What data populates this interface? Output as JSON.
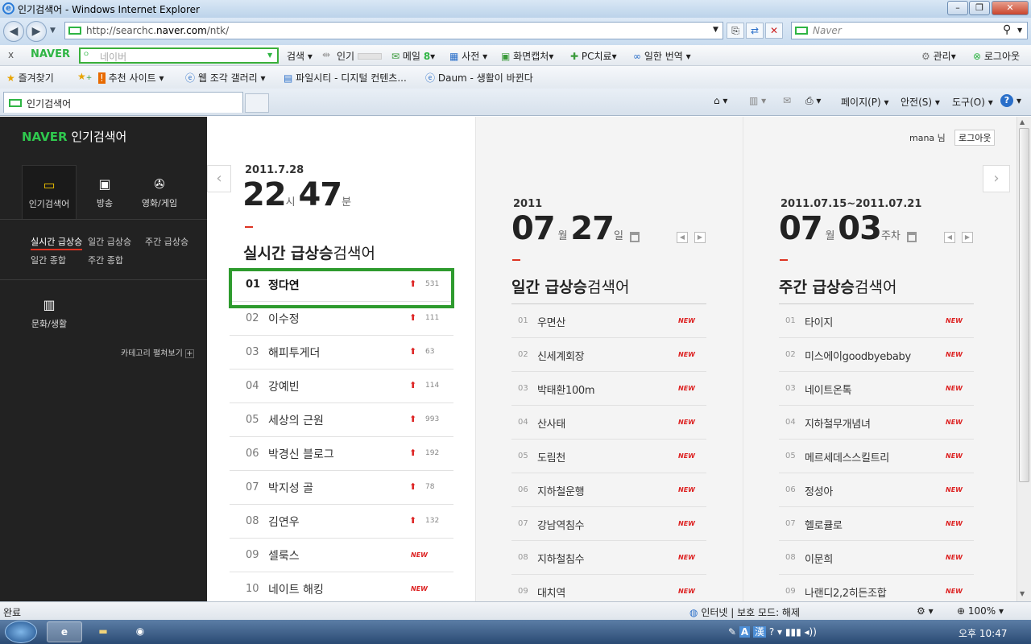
{
  "window": {
    "title": "인기검색어 - Windows Internet Explorer"
  },
  "address": {
    "url_prefix": "http://searchc.",
    "url_domain": "naver.com",
    "url_path": "/ntk/"
  },
  "search": {
    "placeholder": "Naver"
  },
  "naver_toolbar": {
    "close": "x",
    "logo": "NAVER",
    "placeholder": "네이버",
    "search": "검색",
    "popular": "인기",
    "mail": "메일",
    "mail_count": "8",
    "dict": "사전",
    "capture": "화면캡처",
    "pc": "PC치료",
    "translate": "일한 번역",
    "manage": "관리",
    "logout": "로그아웃"
  },
  "favorites": {
    "label": "즐겨찾기",
    "items": [
      "추천 사이트",
      "웹 조각 갤러리",
      "파일시티 - 디지털 컨텐츠...",
      "Daum - 생활이 바뀐다"
    ]
  },
  "tabs": {
    "active": "인기검색어"
  },
  "cmdbar": {
    "page": "페이지(P)",
    "safety": "안전(S)",
    "tools": "도구(O)"
  },
  "sidebar": {
    "brand_logo": "NAVER",
    "brand_text": "인기검색어",
    "icons": [
      {
        "label": "인기검색어",
        "icon": "ticket-icon"
      },
      {
        "label": "방송",
        "icon": "tv-icon"
      },
      {
        "label": "영화/게임",
        "icon": "film-reel-icon"
      }
    ],
    "submenu": [
      "실시간 급상승",
      "일간 급상승",
      "주간 급상승",
      "일간 종합",
      "주간 종합"
    ],
    "culture": "문화/생활",
    "expand": "카테고리 펼쳐보기"
  },
  "user": {
    "name": "mana",
    "suffix": "님",
    "logout": "로그아웃"
  },
  "realtime": {
    "date": "2011.7.28",
    "hour": "22",
    "hour_unit": "시",
    "minute": "47",
    "minute_unit": "분",
    "heading_bold": "실시간 급상승",
    "heading": "검색어",
    "items": [
      {
        "rank": "01",
        "keyword": "정다연",
        "count": "531",
        "new": ""
      },
      {
        "rank": "02",
        "keyword": "이수정",
        "count": "111",
        "new": ""
      },
      {
        "rank": "03",
        "keyword": "해피투게더",
        "count": "63",
        "new": ""
      },
      {
        "rank": "04",
        "keyword": "강예빈",
        "count": "114",
        "new": ""
      },
      {
        "rank": "05",
        "keyword": "세상의 근원",
        "count": "993",
        "new": ""
      },
      {
        "rank": "06",
        "keyword": "박경신 블로그",
        "count": "192",
        "new": ""
      },
      {
        "rank": "07",
        "keyword": "박지성 골",
        "count": "78",
        "new": ""
      },
      {
        "rank": "08",
        "keyword": "김연우",
        "count": "132",
        "new": ""
      },
      {
        "rank": "09",
        "keyword": "셀룩스",
        "count": "",
        "new": "NEW"
      },
      {
        "rank": "10",
        "keyword": "네이트 해킹",
        "count": "",
        "new": "NEW"
      }
    ]
  },
  "daily": {
    "year": "2011",
    "month": "07",
    "month_unit": "월",
    "day": "27",
    "day_unit": "일",
    "heading_bold": "일간 급상승",
    "heading": "검색어",
    "items": [
      {
        "rank": "01",
        "keyword": "우면산",
        "new": "NEW"
      },
      {
        "rank": "02",
        "keyword": "신세계회장",
        "new": "NEW"
      },
      {
        "rank": "03",
        "keyword": "박태환100m",
        "new": "NEW"
      },
      {
        "rank": "04",
        "keyword": "산사태",
        "new": "NEW"
      },
      {
        "rank": "05",
        "keyword": "도림천",
        "new": "NEW"
      },
      {
        "rank": "06",
        "keyword": "지하철운행",
        "new": "NEW"
      },
      {
        "rank": "07",
        "keyword": "강남역침수",
        "new": "NEW"
      },
      {
        "rank": "08",
        "keyword": "지하철침수",
        "new": "NEW"
      },
      {
        "rank": "09",
        "keyword": "대치역",
        "new": "NEW"
      }
    ]
  },
  "weekly": {
    "range": "2011.07.15~2011.07.21",
    "month": "07",
    "month_unit": "월",
    "week": "03",
    "week_unit": "주차",
    "heading_bold": "주간 급상승",
    "heading": "검색어",
    "items": [
      {
        "rank": "01",
        "keyword": "타이지",
        "new": "NEW"
      },
      {
        "rank": "02",
        "keyword": "미스에이goodbyebaby",
        "new": "NEW"
      },
      {
        "rank": "03",
        "keyword": "네이트온톡",
        "new": "NEW"
      },
      {
        "rank": "04",
        "keyword": "지하철무개념녀",
        "new": "NEW"
      },
      {
        "rank": "05",
        "keyword": "메르세데스스킬트리",
        "new": "NEW"
      },
      {
        "rank": "06",
        "keyword": "정성아",
        "new": "NEW"
      },
      {
        "rank": "07",
        "keyword": "헬로큘로",
        "new": "NEW"
      },
      {
        "rank": "08",
        "keyword": "이문희",
        "new": "NEW"
      },
      {
        "rank": "09",
        "keyword": "나랜디2,2히든조합",
        "new": "NEW"
      }
    ]
  },
  "status": {
    "left": "완료",
    "zone": "인터넷 | 보호 모드: 해제",
    "zoom": "100%"
  },
  "taskbar": {
    "time": "오후 10:47",
    "ime_a": "A",
    "ime_han": "漢"
  }
}
